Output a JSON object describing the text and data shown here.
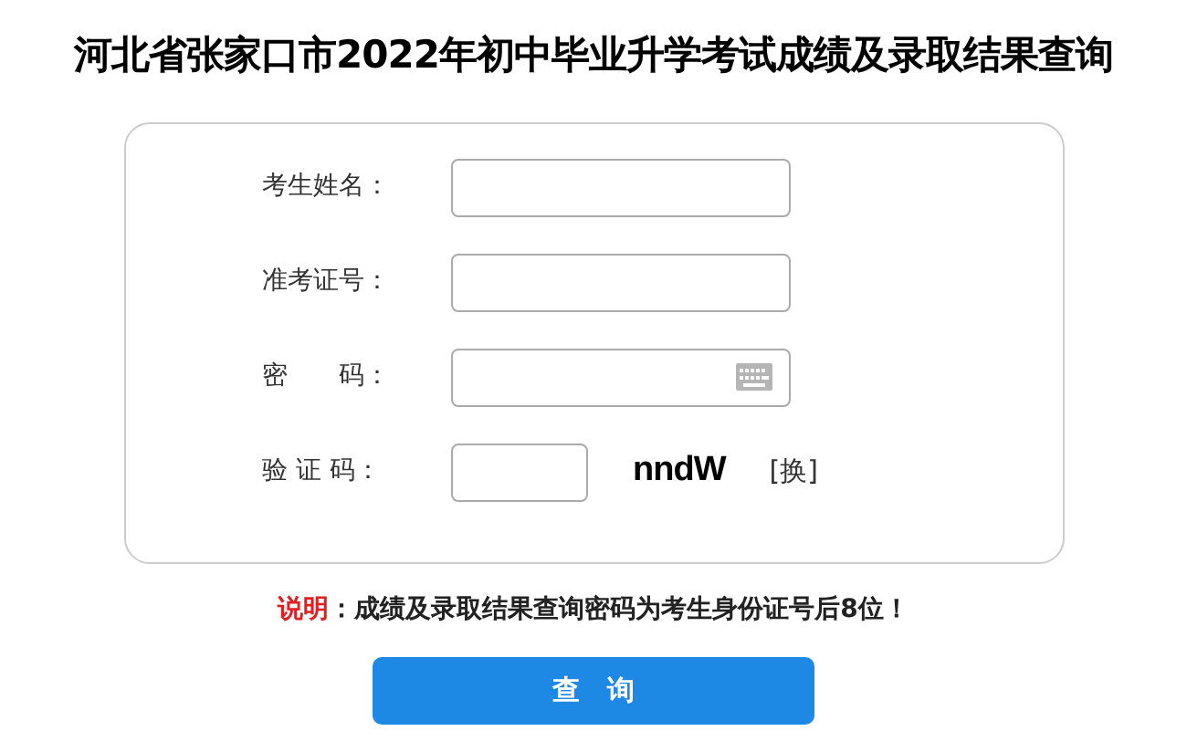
{
  "title": "河北省张家口市2022年初中毕业升学考试成绩及录取结果查询",
  "form": {
    "fields": [
      {
        "kind": "text",
        "label": "考生姓名："
      },
      {
        "kind": "text",
        "label": "准考证号："
      },
      {
        "kind": "password",
        "label": "密　　码："
      },
      {
        "kind": "captcha",
        "label": "验 证 码：",
        "captcha_text": "nndW",
        "refresh": "[换]"
      }
    ]
  },
  "note": {
    "label": "说明",
    "text": "：成绩及录取结果查询密码为考生身份证号后8位！"
  },
  "buttons": [
    "查　询"
  ]
}
